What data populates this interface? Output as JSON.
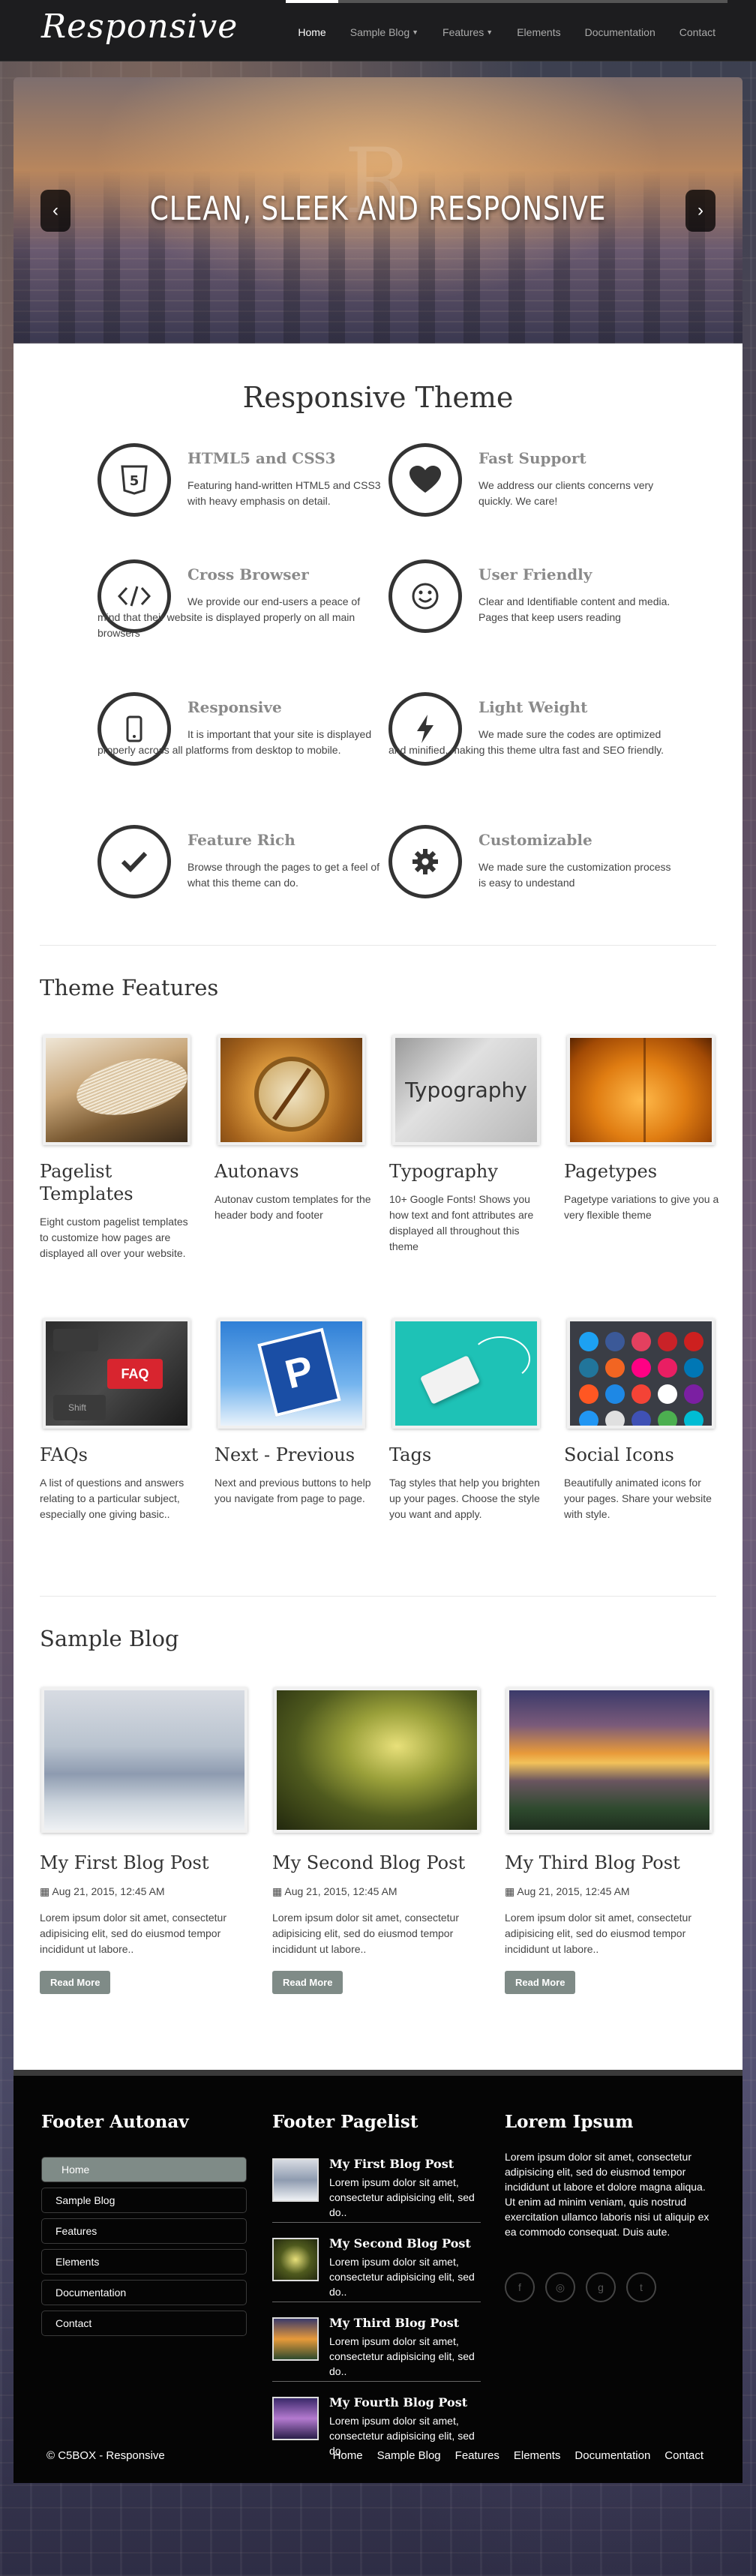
{
  "brand": {
    "logo": "Responsive"
  },
  "nav": {
    "items": [
      {
        "label": "Home",
        "has_dropdown": false,
        "active": true
      },
      {
        "label": "Sample Blog",
        "has_dropdown": true,
        "active": false
      },
      {
        "label": "Features",
        "has_dropdown": true,
        "active": false
      },
      {
        "label": "Elements",
        "has_dropdown": false,
        "active": false
      },
      {
        "label": "Documentation",
        "has_dropdown": false,
        "active": false
      },
      {
        "label": "Contact",
        "has_dropdown": false,
        "active": false
      }
    ]
  },
  "hero": {
    "title": "CLEAN, SLEEK AND RESPONSIVE",
    "prev_icon": "chevron-left-icon",
    "next_icon": "chevron-right-icon",
    "prev_glyph": "‹",
    "next_glyph": "›"
  },
  "intro": {
    "title": "Responsive Theme",
    "features": [
      {
        "title": "HTML5 and CSS3",
        "text": "Featuring hand-written HTML5 and CSS3 with heavy emphasis on detail.",
        "icon": "html5-icon"
      },
      {
        "title": "Fast Support",
        "text": "We address our clients concerns very quickly. We care!",
        "icon": "heart-icon"
      },
      {
        "title": "Cross Browser",
        "text": "We provide our end-users a peace of mind that their website is displayed properly on all main browsers",
        "icon": "code-icon"
      },
      {
        "title": "User Friendly",
        "text": "Clear and Identifiable content and media. Pages that keep users reading",
        "icon": "smile-icon"
      },
      {
        "title": "Responsive",
        "text": "It is important that your site is displayed properly across all platforms from desktop to mobile.",
        "icon": "mobile-icon"
      },
      {
        "title": "Light Weight",
        "text": "We made sure the codes are optimized and minified, making this theme ultra fast and SEO friendly.",
        "icon": "bolt-icon"
      },
      {
        "title": "Feature Rich",
        "text": "Browse through the pages to get a feel of what this theme can do.",
        "icon": "check-icon"
      },
      {
        "title": "Customizable",
        "text": "We made sure the customization process is easy to undestand",
        "icon": "gear-icon"
      }
    ]
  },
  "theme_features": {
    "title": "Theme Features",
    "items": [
      {
        "title": "Pagelist Templates",
        "text": "Eight custom pagelist templates to customize how pages are displayed all over your website."
      },
      {
        "title": "Autonavs",
        "text": "Autonav custom templates for the header body and footer"
      },
      {
        "title": "Typography",
        "text": "10+ Google Fonts! Shows you how text and font attributes are displayed all throughout this theme",
        "image_text": "Typography"
      },
      {
        "title": "Pagetypes",
        "text": "Pagetype variations to give you a very flexible theme"
      },
      {
        "title": "FAQs",
        "text": "A list of questions and answers relating to a particular subject, especially one giving basic..",
        "image_text": "FAQ",
        "image_text_2": "Shift"
      },
      {
        "title": "Next - Previous",
        "text": "Next and previous buttons to help you navigate from page to page."
      },
      {
        "title": "Tags",
        "text": "Tag styles that help you brighten up your pages. Choose the style you want and apply."
      },
      {
        "title": "Social Icons",
        "text": "Beautifully animated icons for your pages. Share your website with style."
      }
    ]
  },
  "blog": {
    "title": "Sample Blog",
    "posts": [
      {
        "title": "My First Blog Post",
        "date": "Aug 21, 2015, 12:45 AM",
        "text": "Lorem ipsum dolor sit amet, consectetur adipisicing elit, sed do eiusmod tempor incididunt ut labore..",
        "button": "Read More"
      },
      {
        "title": "My Second Blog Post",
        "date": "Aug 21, 2015, 12:45 AM",
        "text": "Lorem ipsum dolor sit amet, consectetur adipisicing elit, sed do eiusmod tempor incididunt ut labore..",
        "button": "Read More"
      },
      {
        "title": "My Third Blog Post",
        "date": "Aug 21, 2015, 12:45 AM",
        "text": "Lorem ipsum dolor sit amet, consectetur adipisicing elit, sed do eiusmod tempor incididunt ut labore..",
        "button": "Read More"
      }
    ]
  },
  "footer": {
    "autonav_title": "Footer Autonav",
    "autonav_items": [
      "Home",
      "Sample Blog",
      "Features",
      "Elements",
      "Documentation",
      "Contact"
    ],
    "pagelist_title": "Footer Pagelist",
    "pagelist": [
      {
        "title": "My First Blog Post",
        "text": "Lorem ipsum dolor sit amet, consectetur adipisicing elit, sed do.."
      },
      {
        "title": "My Second Blog Post",
        "text": "Lorem ipsum dolor sit amet, consectetur adipisicing elit, sed do.."
      },
      {
        "title": "My Third Blog Post",
        "text": "Lorem ipsum dolor sit amet, consectetur adipisicing elit, sed do.."
      },
      {
        "title": "My Fourth Blog Post",
        "text": "Lorem ipsum dolor sit amet, consectetur adipisicing elit, sed do.."
      }
    ],
    "lorem_title": "Lorem Ipsum",
    "lorem_text": "Lorem ipsum dolor sit amet, consectetur adipisicing elit, sed do eiusmod tempor incididunt ut labore et dolore magna aliqua. Ut enim ad minim veniam, quis nostrud exercitation ullamco laboris nisi ut aliquip ex ea commodo consequat. Duis aute.",
    "social_icons": [
      "facebook-icon",
      "instagram-icon",
      "google-plus-icon",
      "twitter-icon"
    ],
    "copyright": "© C5BOX - Responsive",
    "bottom_links": [
      "Home",
      "Sample Blog",
      "Features",
      "Elements",
      "Documentation",
      "Contact"
    ]
  },
  "colors": {
    "nav_bg": "#1d1d1f",
    "accent": "#7f8b87",
    "feature_title": "#8a8a8a",
    "footer_bg": "#050505"
  }
}
